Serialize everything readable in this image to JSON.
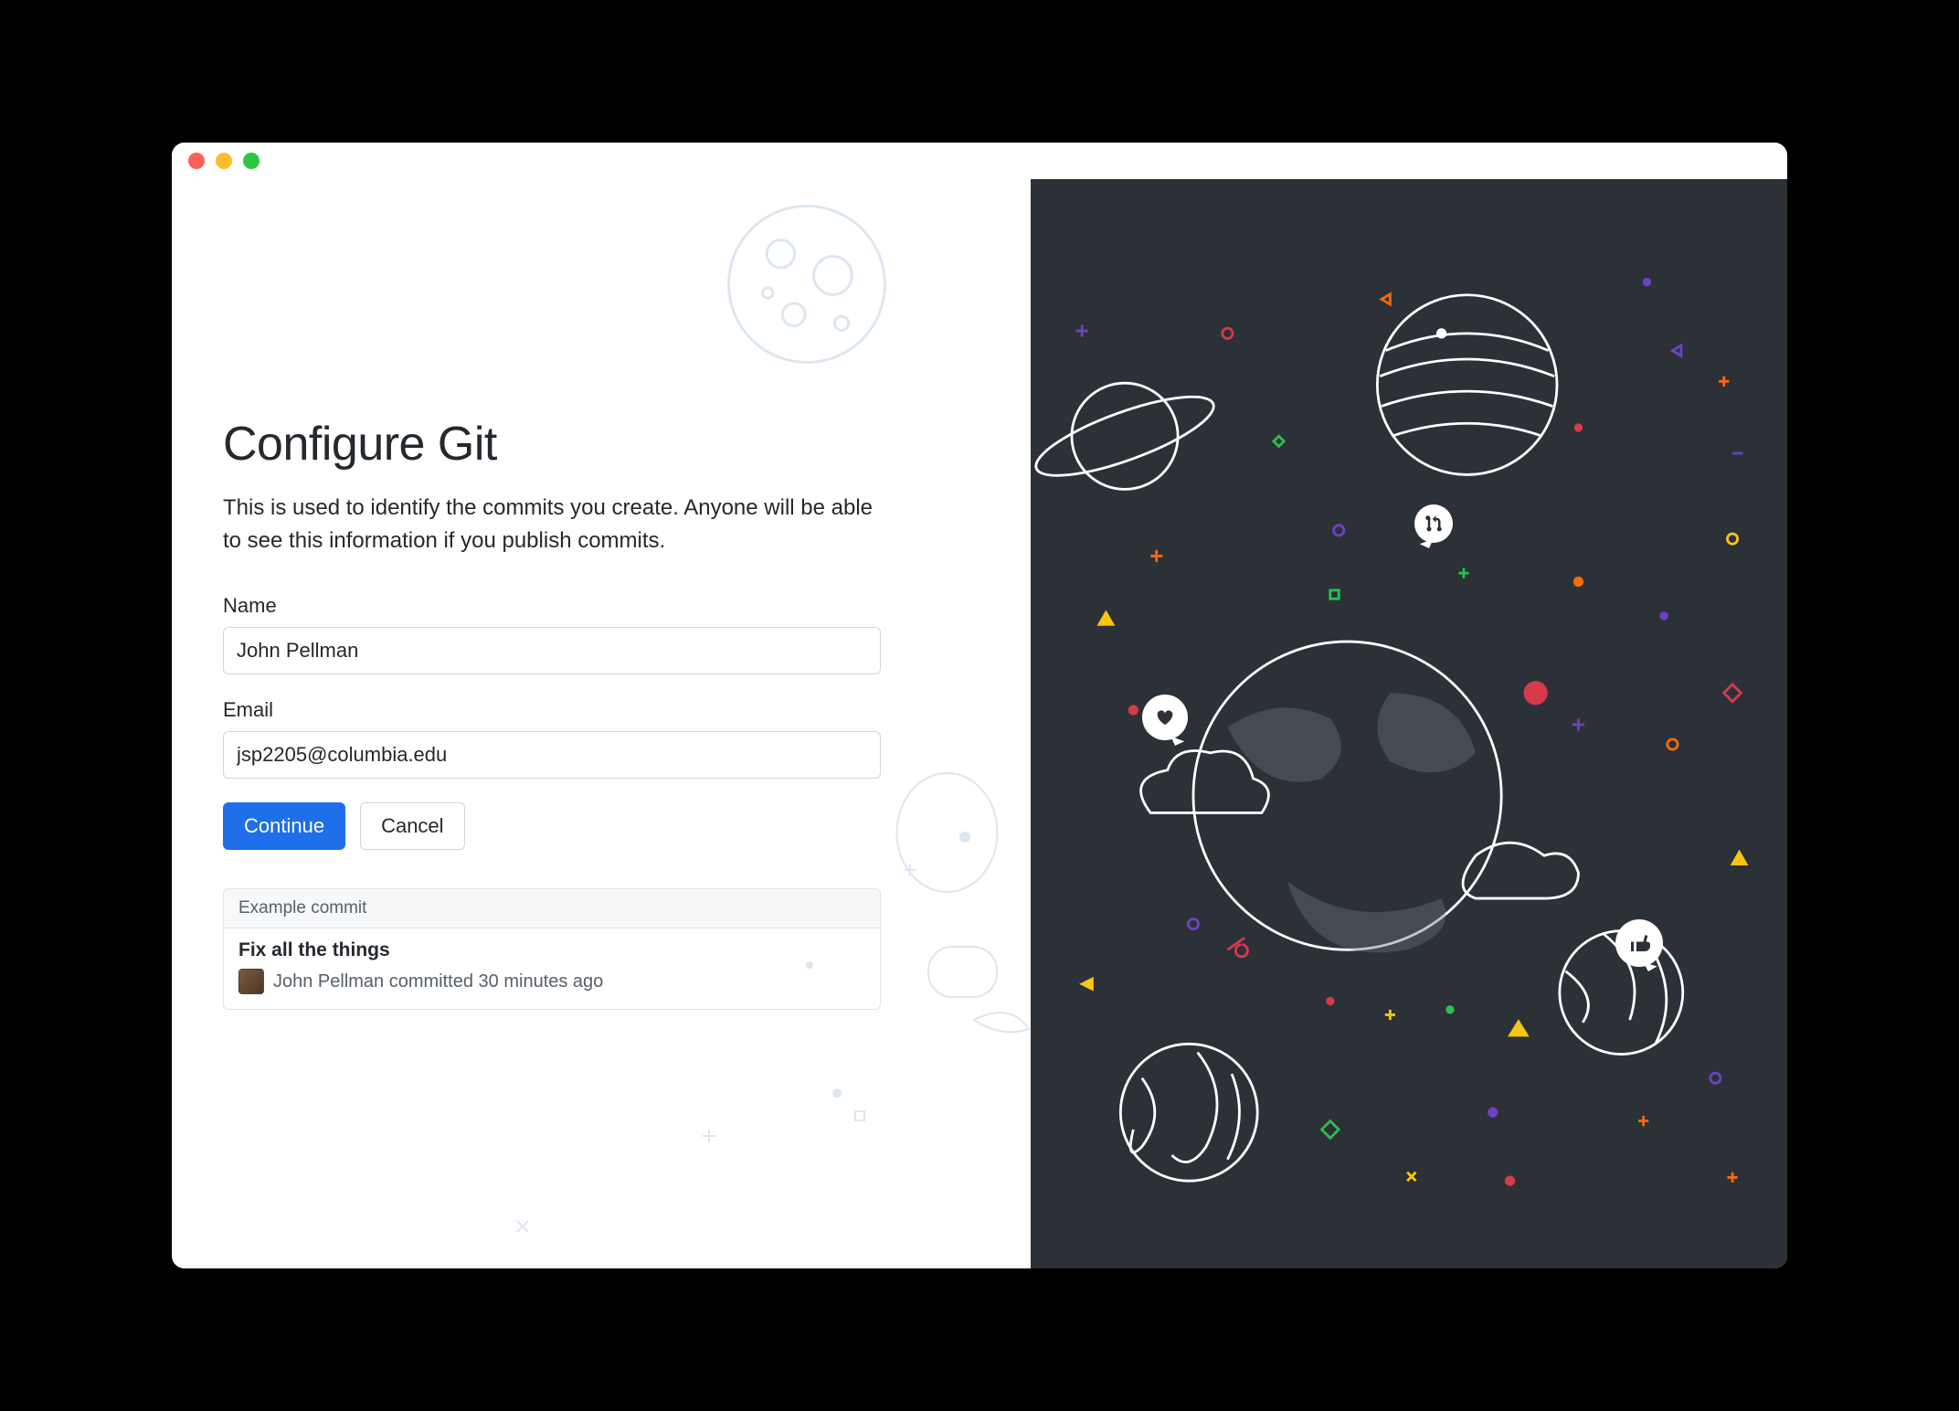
{
  "window": {
    "title": "Configure Git"
  },
  "page": {
    "heading": "Configure Git",
    "description": "This is used to identify the commits you create. Anyone will be able to see this information if you publish commits."
  },
  "form": {
    "name_label": "Name",
    "name_value": "John Pellman",
    "email_label": "Email",
    "email_value": "jsp2205@columbia.edu"
  },
  "buttons": {
    "continue": "Continue",
    "cancel": "Cancel"
  },
  "example": {
    "header": "Example commit",
    "commit_title": "Fix all the things",
    "commit_meta": "John Pellman committed 30 minutes ago"
  },
  "colors": {
    "primary_button": "#1f6feb",
    "right_pane_bg": "#2b3137",
    "accent_yellow": "#f9c513",
    "accent_red": "#d73a49",
    "accent_green": "#2cbe4e",
    "accent_purple": "#6f42c1",
    "accent_orange": "#f66a0a"
  },
  "icons": {
    "bubble_pr": "pull-request-icon",
    "bubble_heart": "heart-icon",
    "bubble_thumb": "thumbs-up-icon"
  }
}
